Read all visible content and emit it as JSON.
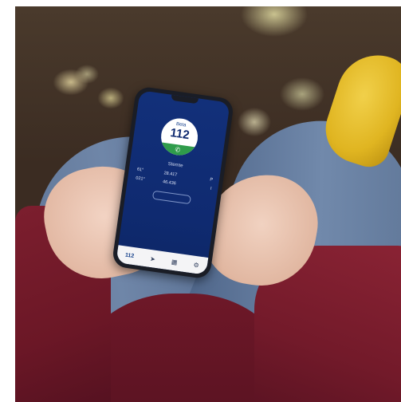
{
  "app": {
    "badge_beta": "Beta",
    "badge_number": "112",
    "call_icon": "phone-icon",
    "location_title": "Stemte",
    "coordinates": [
      {
        "deg": "61°",
        "val": "28.417",
        "dir": "P"
      },
      {
        "deg": "021°",
        "val": "46.436",
        "dir": "I"
      }
    ],
    "pill_label": "",
    "note_text": "",
    "tabs": [
      {
        "label": "112",
        "icon": "112-tab"
      },
      {
        "label": "",
        "icon": "map-icon"
      },
      {
        "label": "",
        "icon": "grid-icon"
      },
      {
        "label": "",
        "icon": "gear-icon"
      }
    ]
  },
  "colors": {
    "screen_blue": "#12307a",
    "call_green": "#2f9c4b",
    "jacket_red": "#7c1e2e",
    "boot_yellow": "#e0b521"
  }
}
